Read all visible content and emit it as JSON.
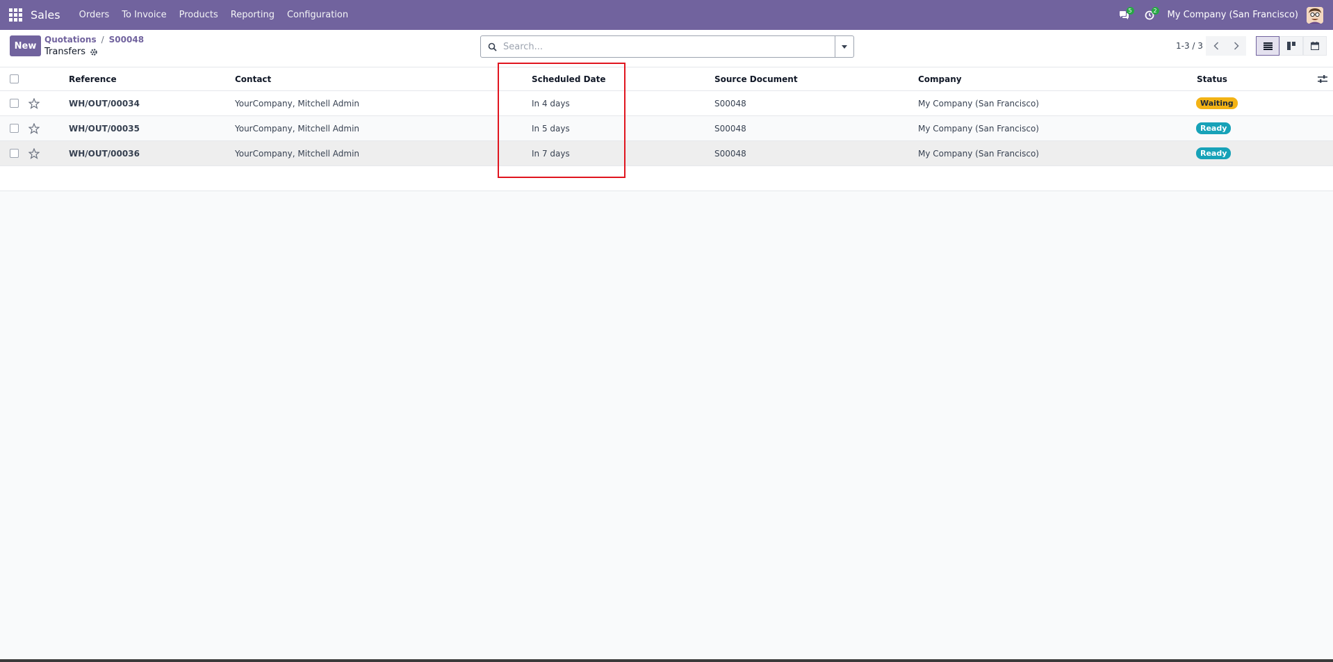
{
  "app": {
    "brand": "Sales",
    "menu": [
      "Orders",
      "To Invoice",
      "Products",
      "Reporting",
      "Configuration"
    ],
    "messages_count": "5",
    "activities_count": "2",
    "company": "My Company (San Francisco)"
  },
  "control": {
    "new_label": "New",
    "breadcrumb": [
      "Quotations",
      "S00048"
    ],
    "breadcrumb_sep": "/",
    "title": "Transfers",
    "search_placeholder": "Search...",
    "pager": "1-3 / 3"
  },
  "table": {
    "columns": [
      "Reference",
      "Contact",
      "Scheduled Date",
      "Source Document",
      "Company",
      "Status"
    ],
    "rows": [
      {
        "reference": "WH/OUT/00034",
        "contact": "YourCompany, Mitchell Admin",
        "scheduled_date": "In 4 days",
        "source": "S00048",
        "company": "My Company (San Francisco)",
        "status": "Waiting"
      },
      {
        "reference": "WH/OUT/00035",
        "contact": "YourCompany, Mitchell Admin",
        "scheduled_date": "In 5 days",
        "source": "S00048",
        "company": "My Company (San Francisco)",
        "status": "Ready"
      },
      {
        "reference": "WH/OUT/00036",
        "contact": "YourCompany, Mitchell Admin",
        "scheduled_date": "In 7 days",
        "source": "S00048",
        "company": "My Company (San Francisco)",
        "status": "Ready"
      }
    ]
  },
  "colors": {
    "brand": "#71639e",
    "waiting": "#f3b315",
    "ready": "#17a2b8",
    "highlight": "#e0141e"
  }
}
